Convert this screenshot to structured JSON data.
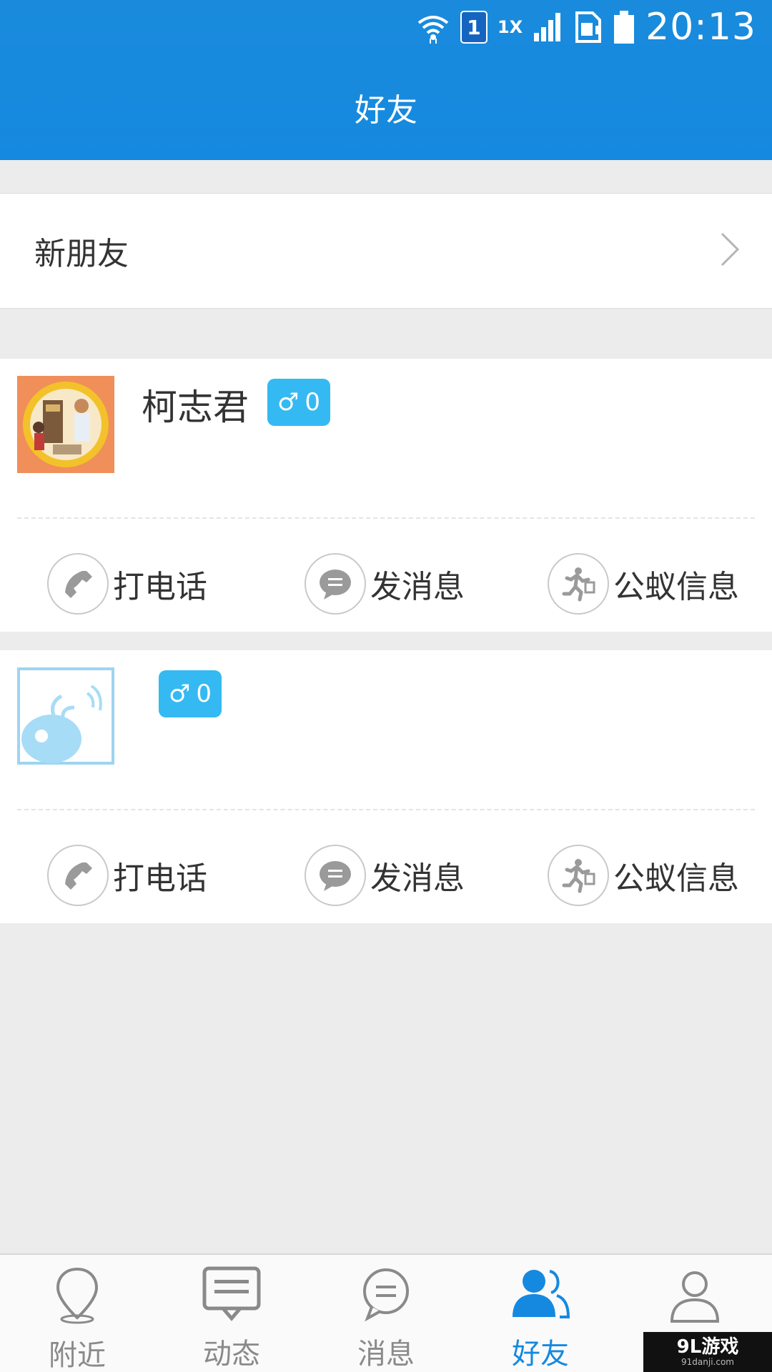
{
  "status_bar": {
    "time": "20:13",
    "sim_slot": "1",
    "network": "1X"
  },
  "header": {
    "title": "好友"
  },
  "new_friends": {
    "label": "新朋友"
  },
  "friends": [
    {
      "name": "柯志君",
      "gender_symbol": "♂",
      "gender_count": "0",
      "actions": {
        "call": "打电话",
        "message": "发消息",
        "info": "公蚁信息"
      }
    },
    {
      "name": "",
      "gender_symbol": "♂",
      "gender_count": "0",
      "actions": {
        "call": "打电话",
        "message": "发消息",
        "info": "公蚁信息"
      }
    }
  ],
  "tabbar": {
    "items": [
      {
        "label": "附近",
        "icon": "location-pin-icon"
      },
      {
        "label": "动态",
        "icon": "feed-icon"
      },
      {
        "label": "消息",
        "icon": "chat-bubble-icon"
      },
      {
        "label": "好友",
        "icon": "friends-icon"
      },
      {
        "label": "",
        "icon": "profile-icon"
      }
    ],
    "active_index": 3
  },
  "watermark": {
    "main": "9L游戏",
    "sub": "91danji.com"
  },
  "colors": {
    "primary": "#1589e0",
    "badge": "#35b9f2",
    "background": "#ececec"
  }
}
